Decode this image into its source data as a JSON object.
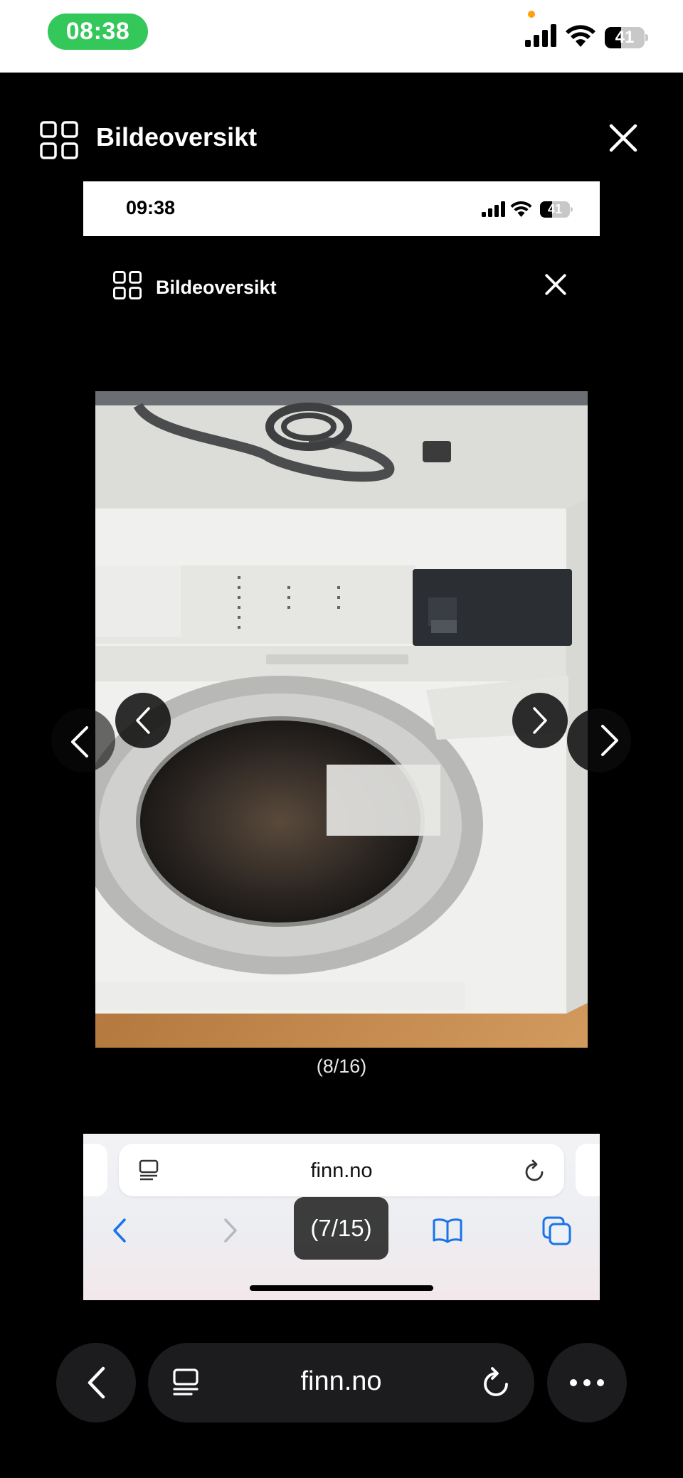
{
  "status_bar": {
    "time": "08:38",
    "battery": "41",
    "battery_level": 0.41
  },
  "header": {
    "title": "Bildeoversikt"
  },
  "inner_screenshot": {
    "status_time": "09:38",
    "battery": "41",
    "battery_level": 0.41,
    "title": "Bildeoversikt",
    "photo_counter": "(8/16)",
    "url": "finn.no"
  },
  "counter_overlay": "(7/15)",
  "toolbar": {
    "url": "finn.no"
  },
  "colors": {
    "time_pill": "#34c759",
    "safari_blue": "#1a73e8"
  },
  "icons": [
    "grid-icon",
    "close-icon",
    "chevron-left-icon",
    "chevron-right-icon",
    "reader-icon",
    "reload-icon",
    "more-icon",
    "book-icon",
    "tabs-icon"
  ]
}
